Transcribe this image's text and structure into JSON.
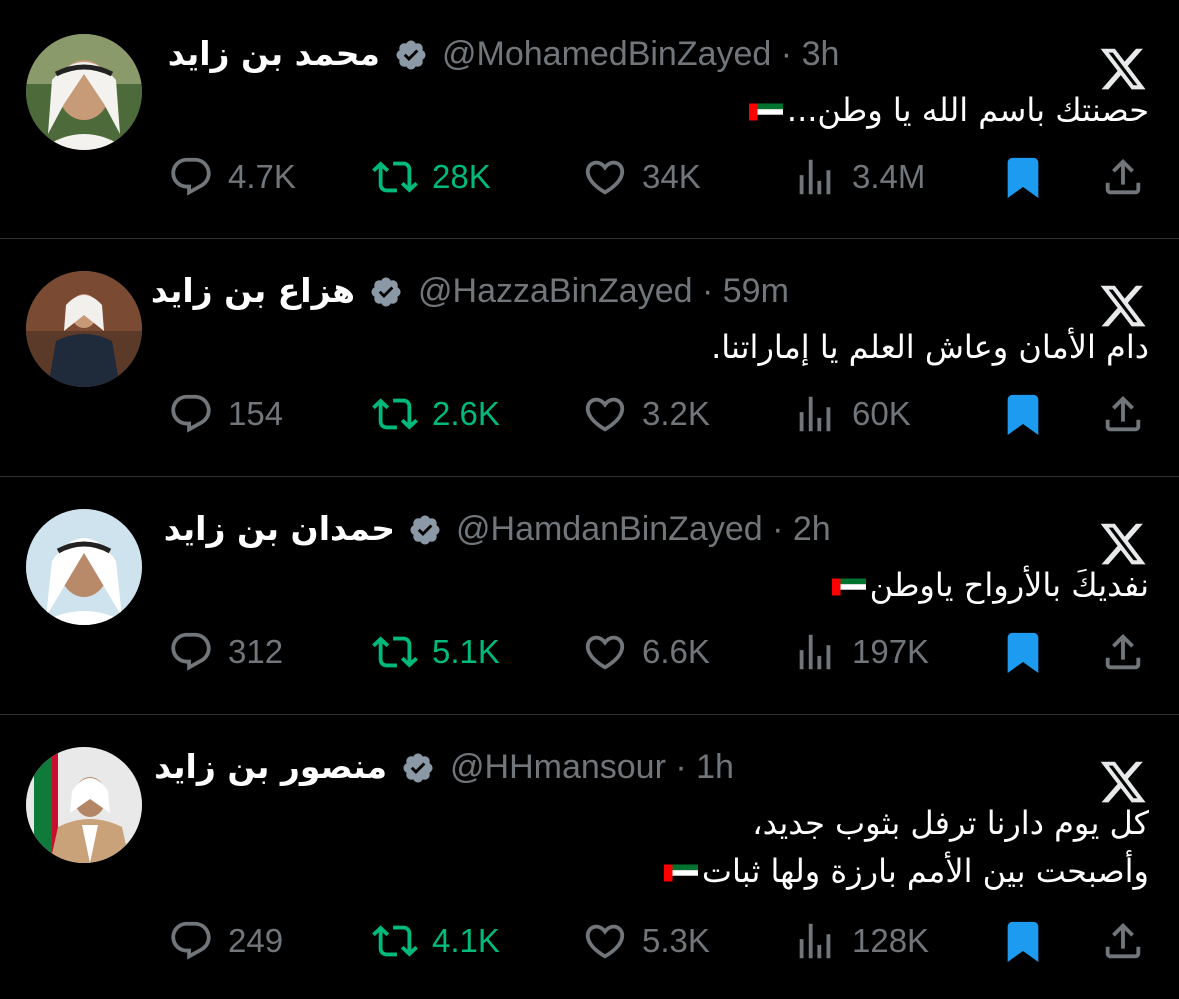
{
  "colors": {
    "background": "#000000",
    "text": "#e7e9ea",
    "muted": "#71767b",
    "retweet": "#00ba7c",
    "bookmark": "#1d9bf0"
  },
  "tweets": [
    {
      "name": "محمد بن زايد",
      "handle": "@MohamedBinZayed",
      "time": "· 3h",
      "text_lines": [
        "حصنتك باسم الله يا وطن..."
      ],
      "flag_line": 0,
      "replies": "4.7K",
      "retweets": "28K",
      "likes": "34K",
      "views": "3.4M"
    },
    {
      "name": "هزاع بن زايد",
      "handle": "@HazzaBinZayed",
      "time": "· 59m",
      "text_lines": [
        "دام الأمان وعاش العلم يا إماراتنا."
      ],
      "flag_line": null,
      "replies": "154",
      "retweets": "2.6K",
      "likes": "3.2K",
      "views": "60K"
    },
    {
      "name": "حمدان بن زايد",
      "handle": "@HamdanBinZayed",
      "time": "· 2h",
      "text_lines": [
        "نفديكَ بالأرواح ياوطن"
      ],
      "flag_line": 0,
      "replies": "312",
      "retweets": "5.1K",
      "likes": "6.6K",
      "views": "197K"
    },
    {
      "name": "منصور بن زايد",
      "handle": "@HHmansour",
      "time": "· 1h",
      "text_lines": [
        "كل يوم دارنا ترفل بثوب جديد،",
        "وأصبحت بين الأمم بارزة ولها ثبات"
      ],
      "flag_line": 1,
      "replies": "249",
      "retweets": "4.1K",
      "likes": "5.3K",
      "views": "128K"
    }
  ],
  "icons": {
    "verified": "verified-badge-icon",
    "x": "x-logo-icon",
    "reply": "reply-icon",
    "retweet": "retweet-icon",
    "like": "heart-icon",
    "views": "views-icon",
    "bookmark": "bookmark-icon",
    "share": "share-icon"
  }
}
